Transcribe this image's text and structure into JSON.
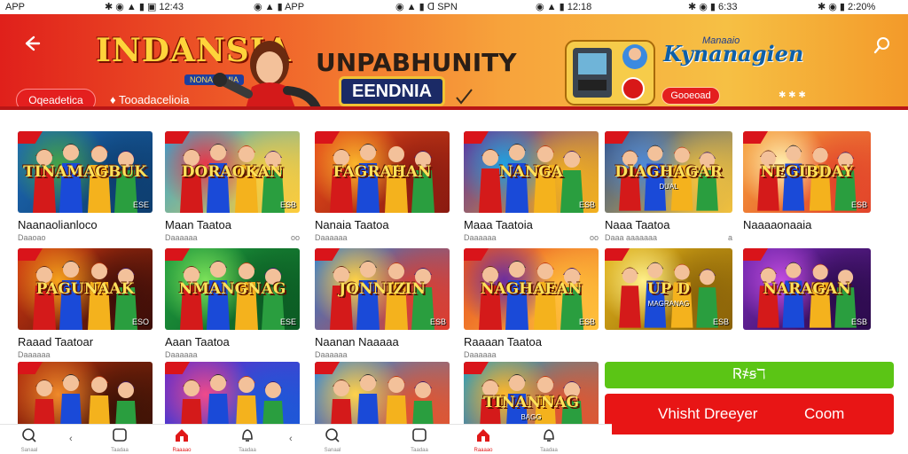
{
  "status_bar": {
    "segments": [
      {
        "text": "APP"
      },
      {
        "text": "✱ ◉ ▲ ▮ ▣ 12:43"
      },
      {
        "text": "◉ ▲ ▮ APP"
      },
      {
        "text": "◉ ▲ ▮ ᗡ SPN"
      },
      {
        "text": "◉ ▲ ▮ 12:18"
      },
      {
        "text": "✱ ◉ ▮ 6:33"
      },
      {
        "text": "✱ ◉ ▮ 2:20%"
      }
    ]
  },
  "header": {
    "hero_title": "INDANSIA",
    "hero_tag": "NONAGAMIA",
    "hero_button": "Oqeadetica",
    "hero_subtitle": "♦ Tooadacelioia",
    "promo_title": "UNPABHUNITY",
    "promo_badge": "EENDNIA",
    "app_name_top": "Manaaio",
    "app_name": "Kynanagien",
    "cta_label": "Gooeoad",
    "dots_text": "✱ ✱ ✱"
  },
  "games": [
    {
      "art": "TINAMAGBUK",
      "sub": "",
      "title": "Naanaolianloco",
      "meta_left": "Daaoao",
      "meta_right": "",
      "tag": "ESE",
      "colors": [
        "#1e6bb8",
        "#44a348",
        "#0d3d6e"
      ]
    },
    {
      "art": "DORAOKAN",
      "sub": "",
      "title": "Maan Taatoa",
      "meta_left": "Daaaaaa",
      "meta_right": "oo",
      "tag": "ESB",
      "colors": [
        "#2aa5d8",
        "#e6374a",
        "#ffcd3a"
      ]
    },
    {
      "art": "FAGRAHAN",
      "sub": "",
      "title": "Nanaia Taatoa",
      "meta_left": "Daaaaaa",
      "meta_right": "",
      "tag": "",
      "colors": [
        "#ec4d1b",
        "#fbb62c",
        "#8a1a10"
      ]
    },
    {
      "art": "NANGA",
      "sub": "",
      "title": "Maaa Taatoia",
      "meta_left": "Daaaaaa",
      "meta_right": "oo",
      "tag": "ESB",
      "colors": [
        "#5b2ba0",
        "#1fa0e0",
        "#f4b21d"
      ]
    },
    {
      "art": "DIAGHAGAR",
      "sub": "DUAL",
      "title": "Naaa Taatoa",
      "meta_left": "Daaa aaaaaaa",
      "meta_right": "a",
      "tag": "",
      "colors": [
        "#2d4f8e",
        "#4f89d6",
        "#f2c13d"
      ]
    },
    {
      "art": "NEGIBDAY",
      "sub": "",
      "title": "Naaaaonaaia",
      "meta_left": "",
      "meta_right": "",
      "tag": "ESB",
      "colors": [
        "#f6a23b",
        "#fff0b0",
        "#e2442a"
      ]
    },
    {
      "art": "PAGUNAAK",
      "sub": "",
      "title": "Raaad Taatoar",
      "meta_left": "Daaaaaa",
      "meta_right": "",
      "tag": "ESO",
      "colors": [
        "#d83a12",
        "#f5a21c",
        "#3a0d08"
      ]
    },
    {
      "art": "NMANGNAG",
      "sub": "",
      "title": "Aaan Taatoa",
      "meta_left": "Daaaaaa",
      "meta_right": "",
      "tag": "ESE",
      "colors": [
        "#1f9e3f",
        "#7de35a",
        "#0b5a23"
      ]
    },
    {
      "art": "JONNIZIN",
      "sub": "",
      "title": "Naanan Naaaaa",
      "meta_left": "Daaaaaa",
      "meta_right": "",
      "tag": "ESB",
      "colors": [
        "#2b7fd6",
        "#ffd245",
        "#e03c2c"
      ]
    },
    {
      "art": "NAGHAEAN",
      "sub": "",
      "title": "Raaaan Taatoa",
      "meta_left": "Daaaaaa",
      "meta_right": "",
      "tag": "ESB",
      "colors": [
        "#e64a20",
        "#6a2da0",
        "#ffc23b"
      ]
    },
    {
      "art": "UP D",
      "sub": "MAGRANAG",
      "title": "",
      "meta_left": "",
      "meta_right": "",
      "tag": "ESB",
      "colors": [
        "#e4b41a",
        "#fff08a",
        "#8a6208"
      ]
    },
    {
      "art": "NARAGAN",
      "sub": "",
      "title": "",
      "meta_left": "",
      "meta_right": "",
      "tag": "ESB",
      "colors": [
        "#7a2ab8",
        "#c24de0",
        "#2a0a4a"
      ]
    },
    {
      "art": "",
      "sub": "",
      "title": "",
      "meta_left": "",
      "meta_right": "",
      "tag": "",
      "colors": [
        "#b8300e",
        "#f08a2a",
        "#3a1206"
      ]
    },
    {
      "art": "",
      "sub": "",
      "title": "",
      "meta_left": "",
      "meta_right": "",
      "tag": "",
      "colors": [
        "#6a2ac8",
        "#f04a8a",
        "#1a5ad8"
      ]
    },
    {
      "art": "",
      "sub": "",
      "title": "",
      "meta_left": "",
      "meta_right": "",
      "tag": "",
      "colors": [
        "#2a8ae0",
        "#ffd24a",
        "#e8532a"
      ]
    },
    {
      "art": "TINANNAG",
      "sub": "BAGG",
      "title": "",
      "meta_left": "",
      "meta_right": "",
      "tag": "",
      "colors": [
        "#1aa0c8",
        "#ffb72a",
        "#e8532a"
      ]
    }
  ],
  "actions": {
    "green_label": "Ꮢ҂ꞩℸ",
    "red_label_left": "Vhisht Dreeyer",
    "red_label_right": "Coom"
  },
  "bottom_nav": [
    {
      "icon": "search",
      "label": "Sanaal",
      "active": false
    },
    {
      "icon": "square",
      "label": "Taadaa",
      "active": false
    },
    {
      "icon": "home",
      "label": "Raaaao",
      "active": true
    },
    {
      "icon": "bell",
      "label": "Taadaa",
      "active": false
    },
    {
      "icon": "search",
      "label": "Sanaal",
      "active": false
    },
    {
      "icon": "square",
      "label": "Taadaa",
      "active": false
    },
    {
      "icon": "home",
      "label": "Raaaao",
      "active": true
    },
    {
      "icon": "bell",
      "label": "Taadaa",
      "active": false
    }
  ],
  "colors": {
    "accent_red": "#e81515",
    "accent_green": "#5bc515",
    "banner_gold": "#f7a23b"
  }
}
